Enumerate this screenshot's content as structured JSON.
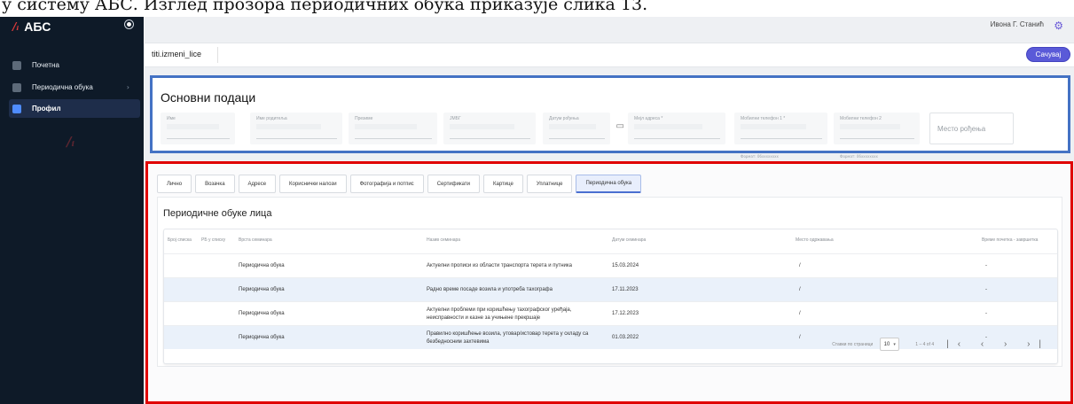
{
  "doc_text": "у систему АБС. Изглед прозора периодичних обука приказује слика 13.",
  "app": {
    "name": "АБС",
    "logo_mark": "/ᵢ"
  },
  "sidebar": {
    "items": [
      {
        "label": "Почетна"
      },
      {
        "label": "Периодична обука",
        "chevron": "›"
      },
      {
        "label": "Профил"
      }
    ]
  },
  "header": {
    "user": "Ивона Г. Станић"
  },
  "toolbar": {
    "crumb": "titi.izmeni_lice",
    "save_label": "Сачувај"
  },
  "basic": {
    "title": "Основни подаци",
    "fields": [
      {
        "label": "Име"
      },
      {
        "label": "Име родитеља"
      },
      {
        "label": "Презиме"
      },
      {
        "label": "ЈМБГ"
      },
      {
        "label": "Датум рођења"
      },
      {
        "label": "Мејл адреса *"
      },
      {
        "label": "Мобилни телефон 1 *",
        "hint": "Формат: 06xxxxxxxx"
      },
      {
        "label": "Мобилни телефон 2",
        "hint": "Формат: 06xxxxxxxx"
      }
    ],
    "place_placeholder": "Место рођења"
  },
  "tabs": [
    {
      "label": "Лично"
    },
    {
      "label": "Возачка"
    },
    {
      "label": "Адресе"
    },
    {
      "label": "Кориснички налози"
    },
    {
      "label": "Фотографија и потпис"
    },
    {
      "label": "Сертификати"
    },
    {
      "label": "Картице"
    },
    {
      "label": "Уплатнице"
    },
    {
      "label": "Периодична обука"
    }
  ],
  "training": {
    "title": "Периодичне обуке лица",
    "columns": [
      "Број списка",
      "РБ у списку",
      "Врста семинара",
      "Назив семинара",
      "Датум семинара",
      "Место одржавања",
      "Време почетка - завршетка"
    ],
    "rows": [
      {
        "type": "Периодична обука",
        "name": "Актуелни прописи из области транспорта терета и путника",
        "date": "15.03.2024",
        "place": "/",
        "time": "-"
      },
      {
        "type": "Периодична обука",
        "name": "Радно време посаде возила и употреба тахографа",
        "date": "17.11.2023",
        "place": "/",
        "time": "-"
      },
      {
        "type": "Периодична обука",
        "name": "Актуелни проблеми при коришћењу тахографског уређаја, неисправности и казне за учињене прекршаје",
        "date": "17.12.2023",
        "place": "/",
        "time": "-"
      },
      {
        "type": "Периодична обука",
        "name": "Правилно коришћење возила, утовар/истовар терета у складу са безбедносним захтевима",
        "date": "01.03.2022",
        "place": "/",
        "time": "-"
      }
    ],
    "pager": {
      "label": "Ставки по страници",
      "size": "10",
      "caret": "▾",
      "range": "1 – 4 of 4",
      "nav": "|‹ ‹ › ›|"
    }
  },
  "icons": {
    "calendar": "▭",
    "user_gear": "⚙"
  }
}
